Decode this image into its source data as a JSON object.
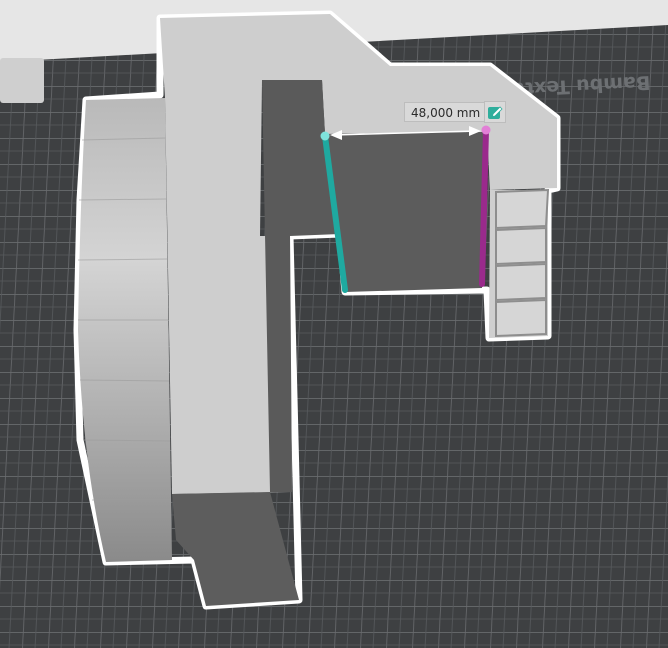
{
  "plate": {
    "watermark_text": "Bambu Textured PEI Plate"
  },
  "measurement": {
    "distance_label": "48,000 mm",
    "edit_icon": "edit-pencil-icon",
    "start_color": "#1fa9a0",
    "end_color": "#9a2a8c"
  },
  "colors": {
    "background": "#3e4042",
    "grid_line": "#6b6d70",
    "model_light": "#cfcfcf",
    "model_dark": "#5f5f5f",
    "outline": "#ffffff"
  }
}
